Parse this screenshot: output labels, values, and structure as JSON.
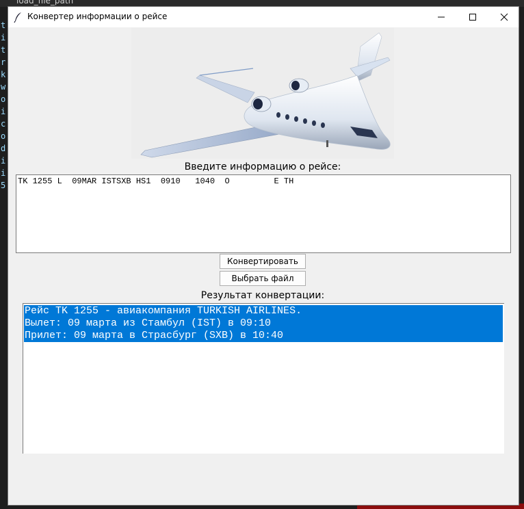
{
  "background": {
    "top_text": "load_file_path",
    "side_fragments": [
      "t",
      "i",
      "t",
      "r",
      "k",
      "w",
      "o",
      "i",
      "c",
      "o",
      "d",
      "i",
      "i",
      "5"
    ]
  },
  "window": {
    "title": "Конвертер информации о рейсе",
    "controls": {
      "minimize": "minimize-icon",
      "maximize": "maximize-icon",
      "close": "close-icon"
    }
  },
  "image": {
    "subject": "business-jet-airplane"
  },
  "input": {
    "label": "Введите информацию о рейсе:",
    "value": "TK 1255 L  09MAR ISTSXB HS1  0910   1040  O         E TH"
  },
  "buttons": {
    "convert": "Конвертировать",
    "choose_file": "Выбрать файл"
  },
  "result": {
    "label": "Результат конвертации:",
    "lines": [
      "Рейс TK 1255 - авиакомпания TURKISH AIRLINES.",
      "Вылет: 09 марта из Стамбул (IST) в 09:10",
      "Прилет: 09 марта в Страсбург (SXB) в 10:40"
    ]
  },
  "colors": {
    "selection": "#0078d7",
    "window_bg": "#f0f0f0"
  }
}
